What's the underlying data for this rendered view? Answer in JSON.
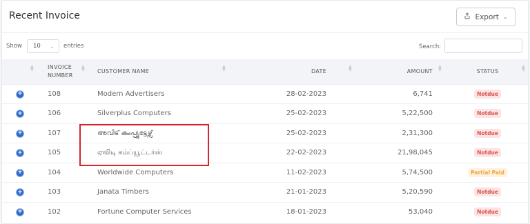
{
  "header": {
    "title": "Recent Invoice",
    "export_label": "Export"
  },
  "controls": {
    "show_label": "Show",
    "length_value": "10",
    "entries_label": "entries",
    "search_label": "Search:"
  },
  "table": {
    "columns": [
      "INVOICE NUMBER",
      "CUSTOMER NAME",
      "DATE",
      "AMOUNT",
      "STATUS"
    ],
    "rows": [
      {
        "number": "108",
        "customer": "Modern Advertisers",
        "date": "28-02-2023",
        "amount": "6,741",
        "status": "Notdue",
        "status_type": "notdue"
      },
      {
        "number": "106",
        "customer": "Silverplus Computers",
        "date": "25-02-2023",
        "amount": "5,22,500",
        "status": "Notdue",
        "status_type": "notdue"
      },
      {
        "number": "107",
        "customer": "അവിട് കംപ്പ്യൂട്ടേഴ്സ്",
        "date": "25-02-2023",
        "amount": "2,31,300",
        "status": "Notdue",
        "status_type": "notdue"
      },
      {
        "number": "105",
        "customer": "ஏவிடி கம்ப்யூட்டர்ஸ்",
        "date": "22-02-2023",
        "amount": "21,98,045",
        "status": "Notdue",
        "status_type": "notdue"
      },
      {
        "number": "104",
        "customer": "Worldwide Computers",
        "date": "11-02-2023",
        "amount": "5,74,500",
        "status": "Partial Paid",
        "status_type": "partial"
      },
      {
        "number": "103",
        "customer": "Janata Timbers",
        "date": "21-01-2023",
        "amount": "5,20,590",
        "status": "Notdue",
        "status_type": "notdue"
      },
      {
        "number": "102",
        "customer": "Fortune Computer Services",
        "date": "18-01-2023",
        "amount": "53,040",
        "status": "Notdue",
        "status_type": "notdue"
      }
    ]
  },
  "colors": {
    "notdue": "#d9534f",
    "partial": "#f0a23c",
    "expand": "#2d6bc9",
    "highlight": "#d0262c"
  },
  "icons": {
    "export": "share-icon",
    "expand": "plus-circle-icon",
    "dropdown": "chevron-down-icon",
    "sort": "sort-icon"
  }
}
